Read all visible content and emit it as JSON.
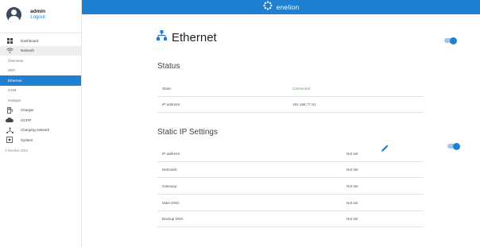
{
  "user": {
    "name": "admin",
    "logout_label": "Logout"
  },
  "sidebar": {
    "items": [
      {
        "label": "Dashboard",
        "icon": "dashboard-icon"
      },
      {
        "label": "Network",
        "icon": "wifi-icon"
      },
      {
        "label": "Charger",
        "icon": "charger-icon"
      },
      {
        "label": "OCPP",
        "icon": "cloud-icon"
      },
      {
        "label": "Charging network",
        "icon": "network-icon"
      },
      {
        "label": "System",
        "icon": "system-icon"
      }
    ],
    "network_sub": [
      "Overview",
      "WiFi",
      "Ethernet",
      "GSM",
      "Hotspot"
    ],
    "active_sub": "Ethernet",
    "copyright": "© Enelion 2023"
  },
  "topbar": {
    "brand": "enelion"
  },
  "page": {
    "title": "Ethernet",
    "enabled": true
  },
  "status": {
    "title": "Status",
    "rows": [
      {
        "key": "State:",
        "value": "Connected"
      },
      {
        "key": "IP address:",
        "value": "192.168.77.91"
      }
    ]
  },
  "static_ip": {
    "title": "Static IP Settings",
    "enabled": true,
    "rows": [
      {
        "key": "IP address:",
        "value": "Not set"
      },
      {
        "key": "Netmask:",
        "value": "Not set"
      },
      {
        "key": "Gateway:",
        "value": "Not set"
      },
      {
        "key": "Main DNS:",
        "value": "Not set"
      },
      {
        "key": "Backup DNS:",
        "value": "Not set"
      }
    ]
  },
  "colors": {
    "accent": "#1f7fd1",
    "connected": "#6a9a6a"
  }
}
